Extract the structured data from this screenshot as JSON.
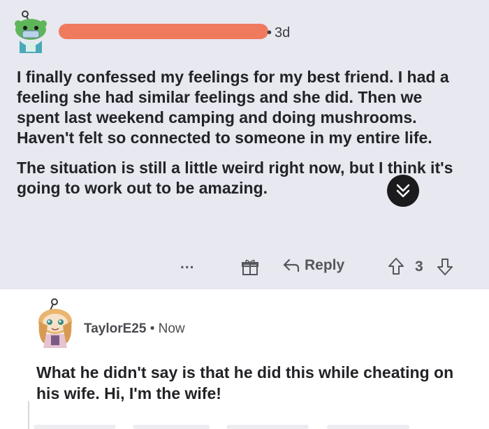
{
  "post": {
    "author_redacted": true,
    "separator": "•",
    "age": "3d",
    "paragraphs": [
      "I finally confessed my feelings for my best friend. I had a feeling she had similar feelings and she did. Then we spent last weekend camping and doing mushrooms. Haven't felt so connected to someone in my entire life.",
      "The situation is still a little weird right now, but I think it's going to work out to be amazing."
    ],
    "badge_icon": "chevron-double-down-icon",
    "actions": {
      "more_label": "...",
      "award_icon": "gift-icon",
      "reply_icon": "reply-arrow-icon",
      "reply_label": "Reply",
      "upvote_icon": "upvote-arrow-icon",
      "score": "3",
      "downvote_icon": "downvote-arrow-icon"
    }
  },
  "comment": {
    "username": "TaylorE25",
    "separator": "•",
    "age": "Now",
    "text": "What he didn't say is that he did this while cheating on his wife. Hi, I'm the wife!"
  },
  "colors": {
    "post_background": "#e7e8f0",
    "comment_background": "#ffffff",
    "redaction": "#f07a5e",
    "text": "#222326",
    "meta": "#4a4b50"
  }
}
